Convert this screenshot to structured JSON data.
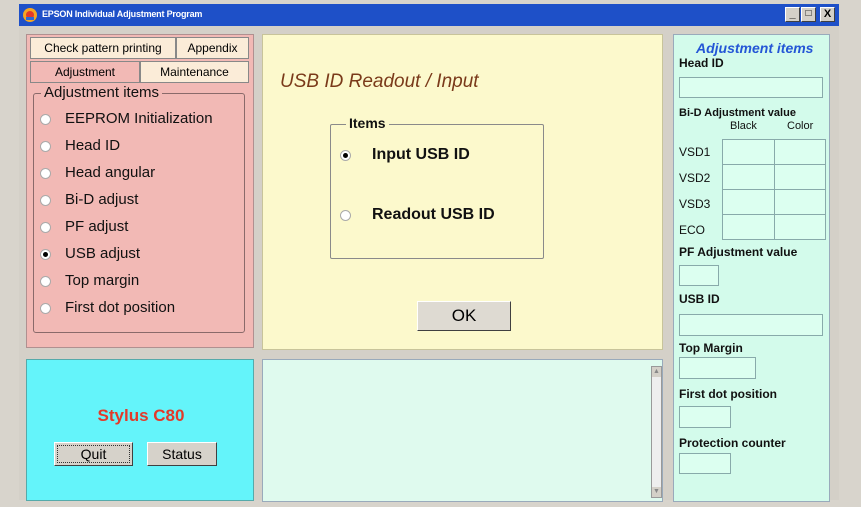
{
  "window": {
    "title": "EPSON Individual Adjustment Program",
    "controls": {
      "minimize": "_",
      "maximize": "□",
      "close": "X"
    }
  },
  "tabs": {
    "row1": [
      "Check pattern printing",
      "Appendix"
    ],
    "row2": [
      "Adjustment",
      "Maintenance"
    ],
    "active": "Adjustment"
  },
  "adjustment_items": {
    "legend": "Adjustment items",
    "options": [
      "EEPROM Initialization",
      "Head ID",
      "Head angular",
      "Bi-D adjust",
      "PF adjust",
      "USB adjust",
      "Top margin",
      "First dot position"
    ],
    "selected": "USB adjust"
  },
  "center": {
    "title": "USB ID Readout / Input",
    "items_legend": "Items",
    "items": [
      "Input USB ID",
      "Readout USB ID"
    ],
    "selected": "Input USB ID",
    "ok_label": "OK"
  },
  "model": {
    "name": "Stylus C80",
    "quit_label": "Quit",
    "status_label": "Status"
  },
  "right": {
    "title": "Adjustment items",
    "head_id_label": "Head ID",
    "bid_label": "Bi-D Adjustment value",
    "col_black": "Black",
    "col_color": "Color",
    "rows": [
      "VSD1",
      "VSD2",
      "VSD3",
      "ECO"
    ],
    "pf_label": "PF Adjustment value",
    "usb_label": "USB ID",
    "top_margin_label": "Top Margin",
    "first_dot_label": "First dot position",
    "protection_label": "Protection counter"
  },
  "colors": {
    "title_bar": "#1e50c8",
    "left_panel": "#f2b9b5",
    "center_panel": "#fcf9cc",
    "model_panel": "#64f4fa",
    "right_panel": "#d3fbeb",
    "accent_title": "#2456d6",
    "model_text": "#e23a2a"
  }
}
